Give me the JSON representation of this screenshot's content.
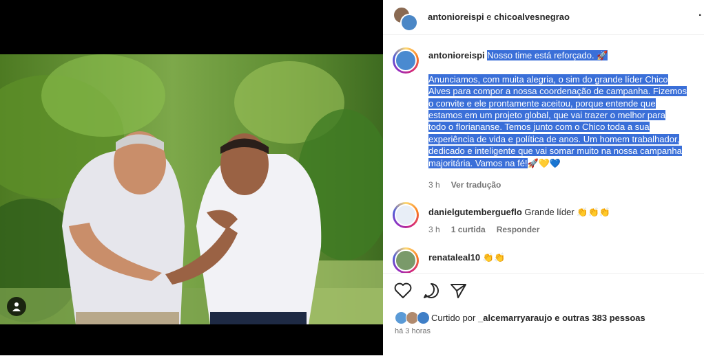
{
  "header": {
    "user1": "antonioreispi",
    "joiner": "e",
    "user2": "chicoalvesnegrao",
    "more_glyph": "·"
  },
  "caption": {
    "username": "antonioreispi",
    "title_line": "Nosso time está reforçado.",
    "title_emoji": "🚀",
    "body_lines": [
      "Anunciamos, com muita alegria, o sim do grande líder Chico",
      "Alves para compor a nossa coordenação de campanha. Fizemos",
      "o convite e ele prontamente aceitou, porque entende que",
      "estamos em um projeto global, que vai trazer o melhor para",
      "todo o floriananse. Temos junto com o Chico toda a sua",
      "experiência de vida e política de anos. Um homem trabalhador,",
      "dedicado e inteligente que vai somar muito na nossa campanha",
      "majoritária. Vamos na fé!"
    ],
    "end_emojis": "🚀💛💙",
    "time": "3 h",
    "translate_label": "Ver tradução"
  },
  "comments": [
    {
      "username": "danielgutembergueflo",
      "text": "Grande líder 👏👏👏",
      "time": "3 h",
      "likes": "1 curtida",
      "reply_label": "Responder"
    },
    {
      "username": "renataleal10",
      "text": "👏👏"
    }
  ],
  "actions": {
    "liked_prefix": "Curtido por",
    "liked_user": "_alcemarryaraujo",
    "liked_suffix": "e outras 383 pessoas",
    "time_ago": "há 3 horas"
  },
  "icons": [
    "person-tag-icon",
    "heart-icon",
    "comment-icon",
    "share-icon",
    "more-icon"
  ],
  "colors": {
    "selection": "#3a6fd8",
    "muted": "#737373",
    "text": "#262626"
  }
}
